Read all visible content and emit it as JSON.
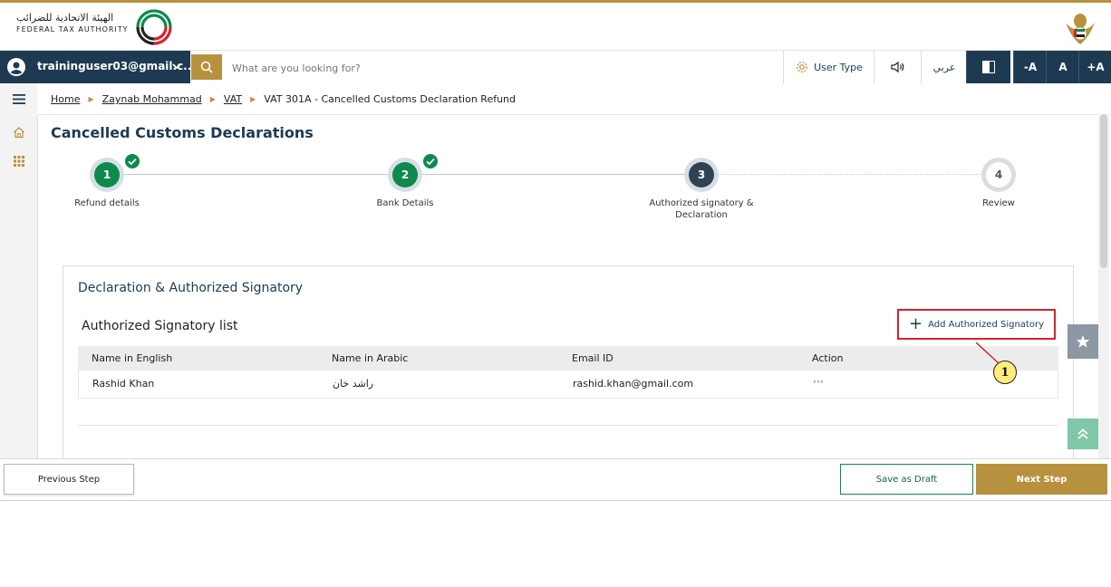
{
  "header": {
    "logo_arabic": "الهيئة الاتحادية للضرائب",
    "logo_english": "FEDERAL TAX AUTHORITY"
  },
  "navbar": {
    "user_email": "traininguser03@gmail.c...",
    "search_placeholder": "What are you looking for?",
    "user_type_label": "User Type",
    "arabic_label": "عربي",
    "font_decrease": "-A",
    "font_normal": "A",
    "font_increase": "+A"
  },
  "breadcrumb": {
    "items": [
      "Home",
      "Zaynab Mohammad",
      "VAT",
      "VAT 301A - Cancelled Customs Declaration Refund"
    ]
  },
  "page": {
    "title": "Cancelled Customs Declarations"
  },
  "stepper": {
    "steps": [
      {
        "number": "1",
        "label": "Refund details",
        "status": "done"
      },
      {
        "number": "2",
        "label": "Bank Details",
        "status": "done"
      },
      {
        "number": "3",
        "label": "Authorized signatory & Declaration",
        "status": "active"
      },
      {
        "number": "4",
        "label": "Review",
        "status": "todo"
      }
    ]
  },
  "declaration": {
    "section_title": "Declaration & Authorized Signatory",
    "list_title": "Authorized Signatory list",
    "add_button_label": "Add Authorized Signatory",
    "columns": [
      "Name in English",
      "Name in Arabic",
      "Email ID",
      "Action"
    ],
    "rows": [
      {
        "name_en": "Rashid Khan",
        "name_ar": "راشد خان",
        "email": "rashid.khan@gmail.com",
        "action": "°°°"
      }
    ]
  },
  "annotation": {
    "callout_number": "1"
  },
  "footer": {
    "previous_label": "Previous Step",
    "draft_label": "Save as Draft",
    "next_label": "Next Step"
  },
  "colors": {
    "primary_navy": "#1e3a52",
    "gold": "#b8913f",
    "success_green": "#0e8a4e",
    "callout_red": "#d9212c"
  }
}
